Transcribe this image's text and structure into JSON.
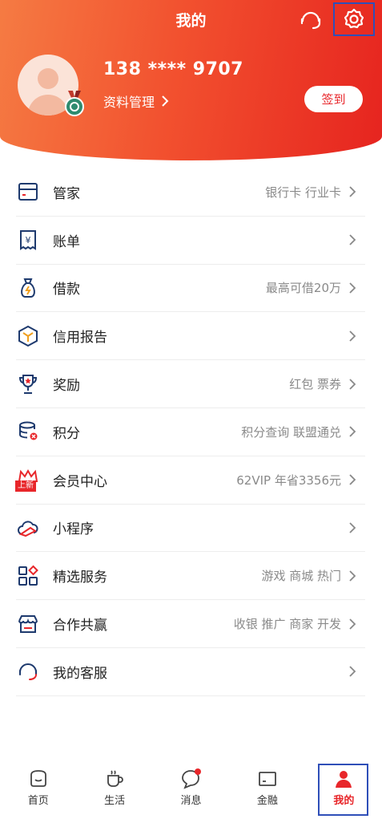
{
  "header": {
    "title": "我的",
    "phone": "138 **** 9707",
    "profile_link": "资料管理",
    "checkin": "签到"
  },
  "menu": [
    {
      "label": "管家",
      "sub": "银行卡 行业卡",
      "icon": "card-icon"
    },
    {
      "label": "账单",
      "sub": "",
      "icon": "bill-icon"
    },
    {
      "label": "借款",
      "sub": "最高可借20万",
      "icon": "loan-bag-icon"
    },
    {
      "label": "信用报告",
      "sub": "",
      "icon": "credit-cube-icon"
    },
    {
      "label": "奖励",
      "sub": "红包 票券",
      "icon": "trophy-icon"
    },
    {
      "label": "积分",
      "sub": "积分查询 联盟通兑",
      "icon": "points-coins-icon"
    },
    {
      "label": "会员中心",
      "sub": "62VIP 年省3356元",
      "icon": "crown-icon",
      "badge": "上新"
    },
    {
      "label": "小程序",
      "sub": "",
      "icon": "cloud-icon"
    },
    {
      "label": "精选服务",
      "sub": "游戏 商城 热门",
      "icon": "grid-apps-icon"
    },
    {
      "label": "合作共赢",
      "sub": "收银 推广 商家 开发",
      "icon": "store-icon"
    },
    {
      "label": "我的客服",
      "sub": "",
      "icon": "headset-icon"
    }
  ],
  "tabs": [
    {
      "label": "首页",
      "icon": "home-icon"
    },
    {
      "label": "生活",
      "icon": "cup-icon"
    },
    {
      "label": "消息",
      "icon": "message-icon"
    },
    {
      "label": "金融",
      "icon": "finance-card-icon"
    },
    {
      "label": "我的",
      "icon": "profile-icon"
    }
  ],
  "colors": {
    "accent": "#e8262a",
    "header_start": "#f57b43",
    "header_end": "#e6241f",
    "highlight": "#2f4fb8",
    "icon_navy": "#1e3a6e"
  }
}
